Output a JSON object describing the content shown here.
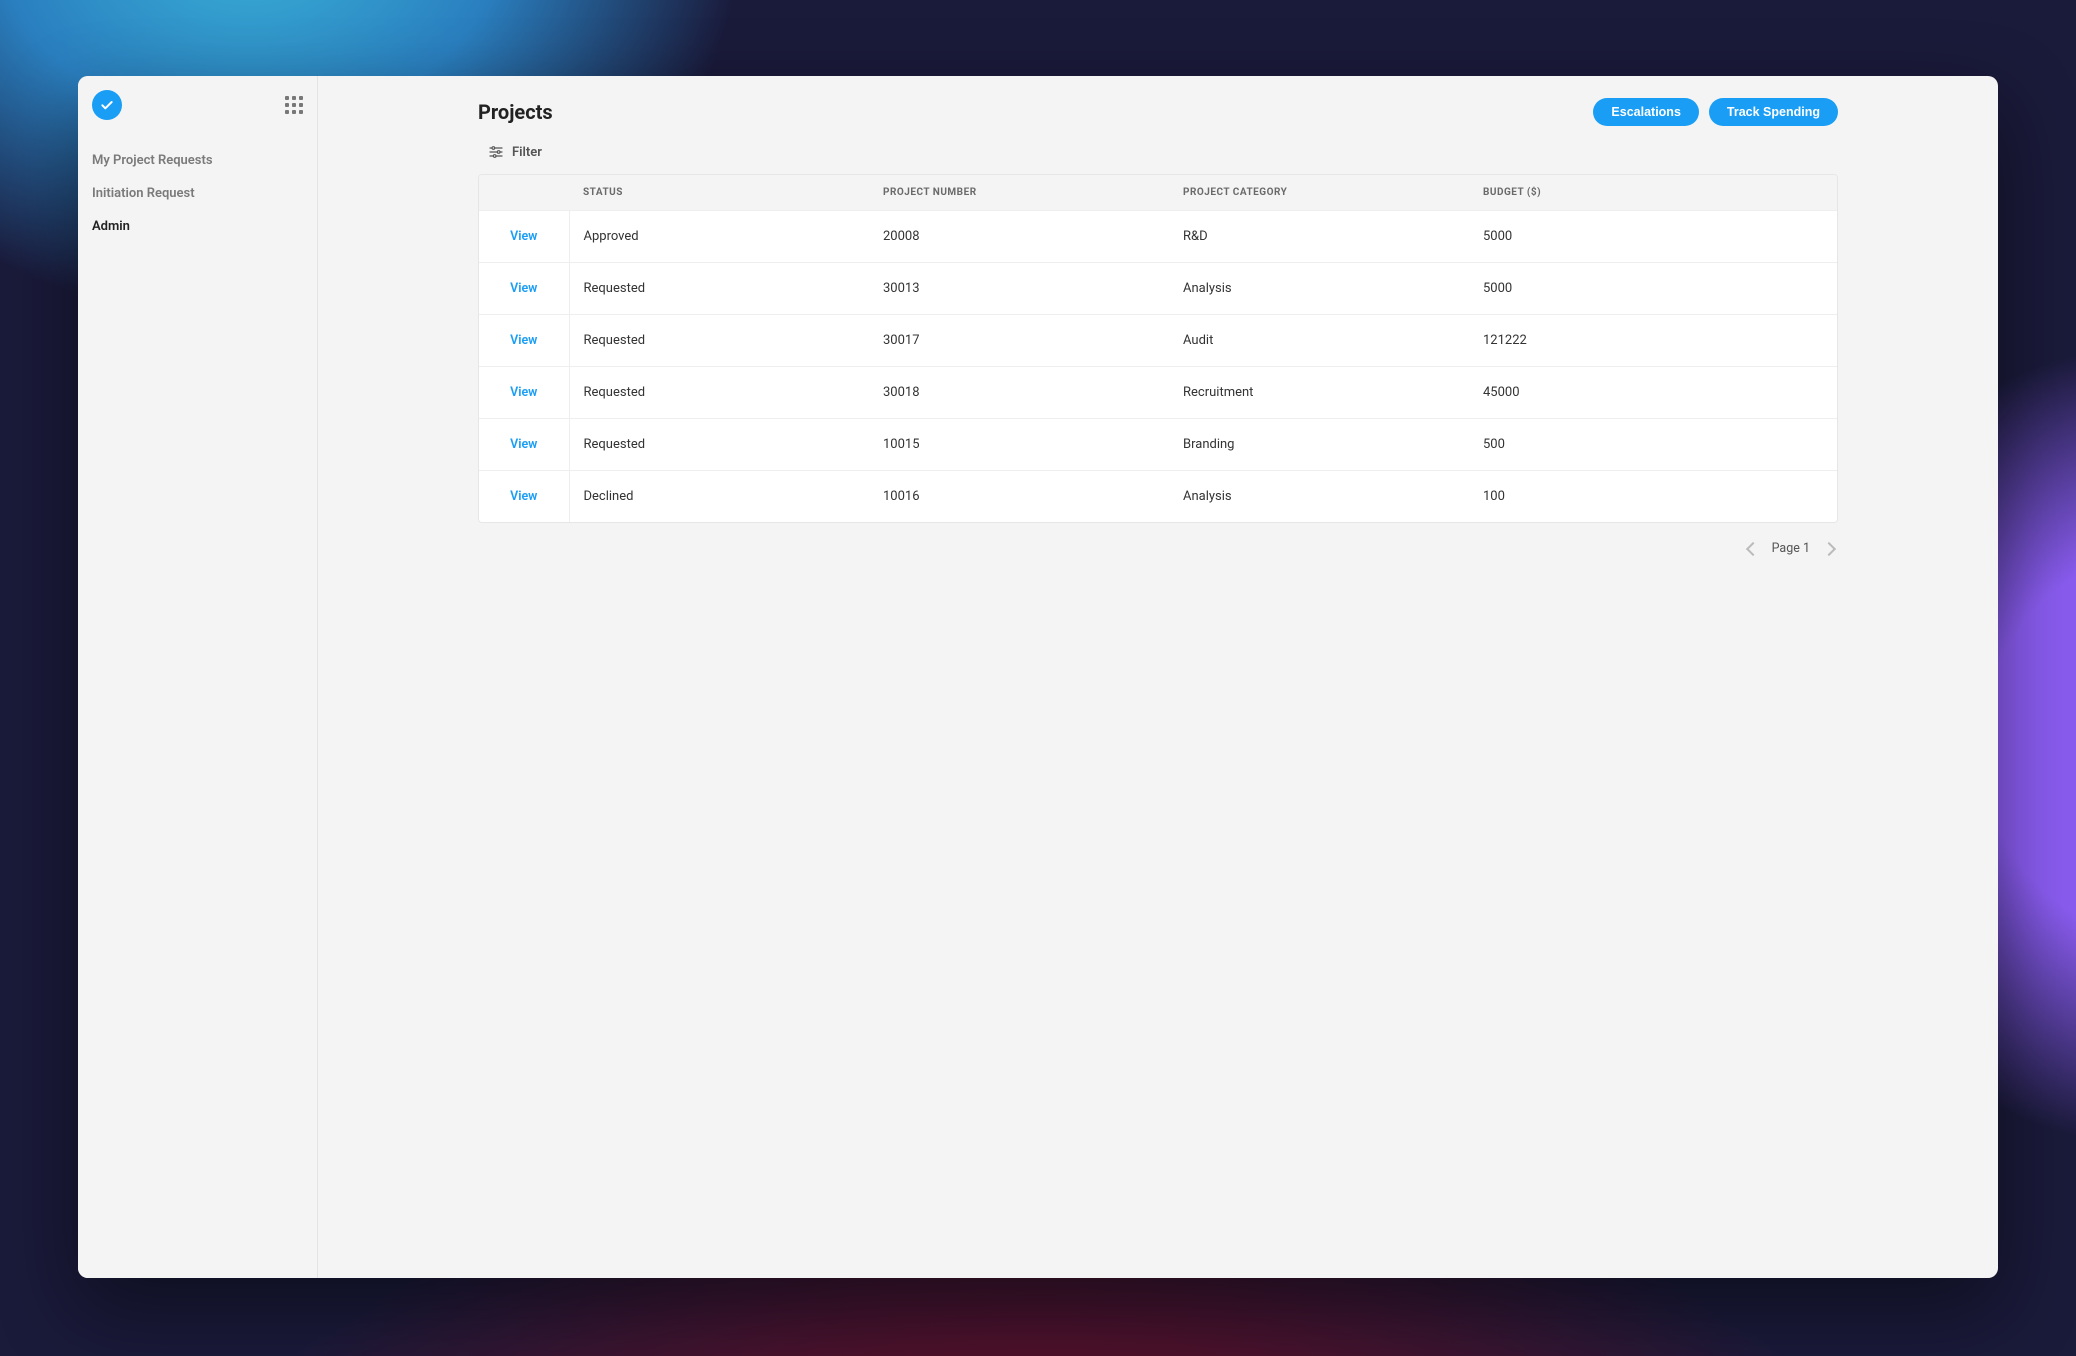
{
  "sidebar": {
    "items": [
      {
        "label": "My Project Requests",
        "active": false
      },
      {
        "label": "Initiation Request",
        "active": false
      },
      {
        "label": "Admin",
        "active": true
      }
    ]
  },
  "header": {
    "title": "Projects",
    "actions": {
      "escalations": "Escalations",
      "track_spending": "Track Spending"
    }
  },
  "filter": {
    "label": "Filter"
  },
  "table": {
    "columns": {
      "action": "",
      "status": "STATUS",
      "project_number": "PROJECT NUMBER",
      "project_category": "PROJECT CATEGORY",
      "budget": "BUDGET ($)"
    },
    "view_label": "View",
    "rows": [
      {
        "status": "Approved",
        "project_number": "20008",
        "project_category": "R&D",
        "budget": "5000"
      },
      {
        "status": "Requested",
        "project_number": "30013",
        "project_category": "Analysis",
        "budget": "5000"
      },
      {
        "status": "Requested",
        "project_number": "30017",
        "project_category": "Audit",
        "budget": "121222"
      },
      {
        "status": "Requested",
        "project_number": "30018",
        "project_category": "Recruitment",
        "budget": "45000"
      },
      {
        "status": "Requested",
        "project_number": "10015",
        "project_category": "Branding",
        "budget": "500"
      },
      {
        "status": "Declined",
        "project_number": "10016",
        "project_category": "Analysis",
        "budget": "100"
      }
    ]
  },
  "pagination": {
    "label": "Page 1"
  }
}
